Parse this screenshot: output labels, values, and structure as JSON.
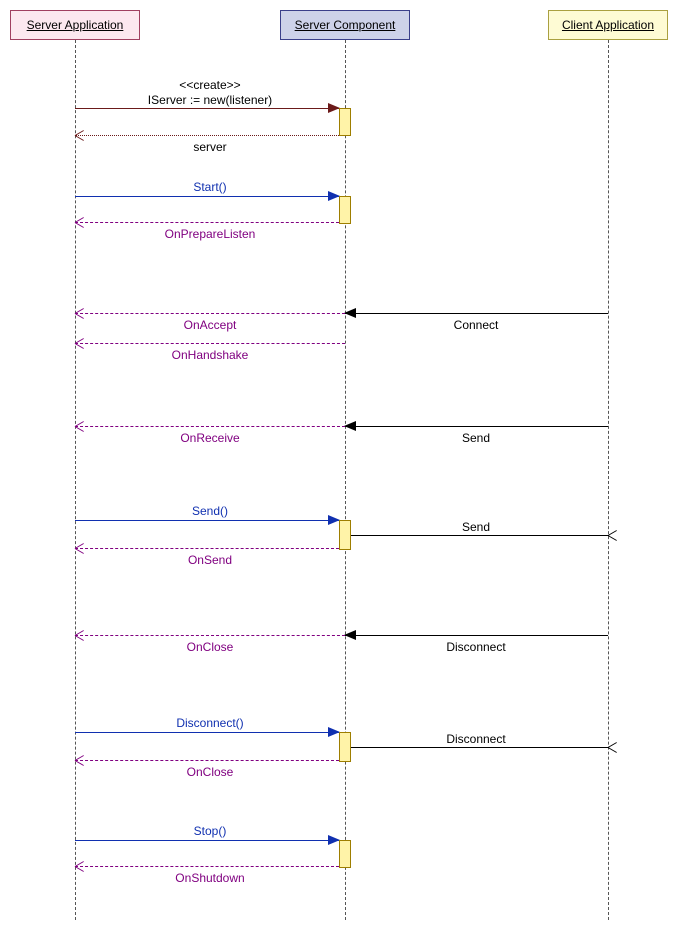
{
  "participants": {
    "server_app": "Server Application",
    "server_comp": "Server Component",
    "client_app": "Client Application"
  },
  "messages": {
    "create_stereo": "<<create>>",
    "create": "IServer := new(listener)",
    "server_return": "server",
    "start": "Start()",
    "on_prepare_listen": "OnPrepareListen",
    "connect": "Connect",
    "on_accept": "OnAccept",
    "on_handshake": "OnHandshake",
    "send_client_to_comp": "Send",
    "on_receive": "OnReceive",
    "send_call": "Send()",
    "send_comp_to_client": "Send",
    "on_send": "OnSend",
    "disconnect_client": "Disconnect",
    "on_close1": "OnClose",
    "disconnect_call": "Disconnect()",
    "disconnect_comp_to_client": "Disconnect",
    "on_close2": "OnClose",
    "stop": "Stop()",
    "on_shutdown": "OnShutdown"
  }
}
